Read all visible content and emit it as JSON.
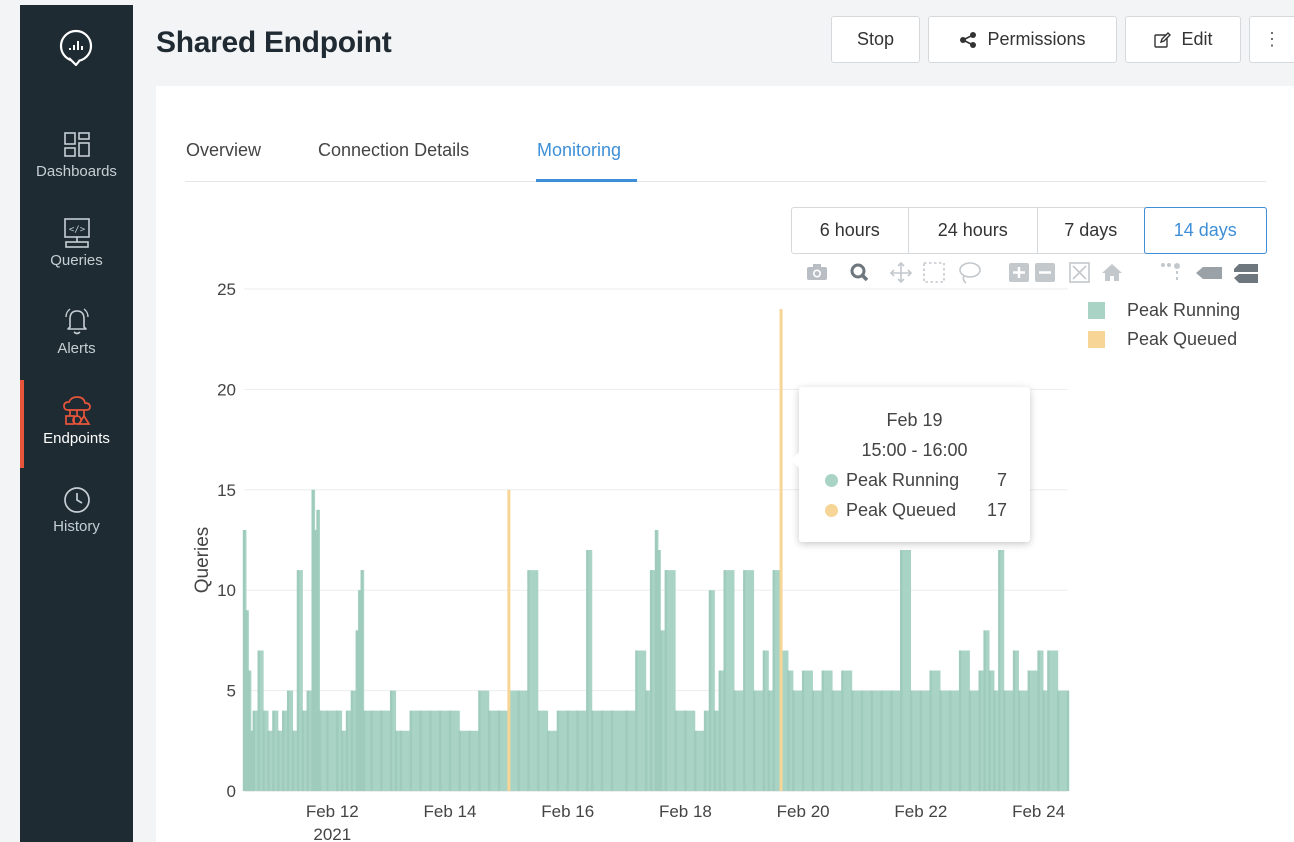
{
  "sidebar": {
    "items": [
      {
        "label": "Dashboards",
        "icon": "dashboards-icon"
      },
      {
        "label": "Queries",
        "icon": "queries-icon"
      },
      {
        "label": "Alerts",
        "icon": "bell-icon"
      },
      {
        "label": "Endpoints",
        "icon": "endpoints-icon",
        "active": true
      },
      {
        "label": "History",
        "icon": "clock-icon"
      }
    ]
  },
  "header": {
    "title": "Shared Endpoint",
    "stop_label": "Stop",
    "permissions_label": "Permissions",
    "edit_label": "Edit",
    "more_label": "⋮"
  },
  "tabs": [
    {
      "label": "Overview"
    },
    {
      "label": "Connection Details"
    },
    {
      "label": "Monitoring",
      "active": true
    }
  ],
  "range": {
    "options": [
      "6 hours",
      "24 hours",
      "7 days",
      "14 days"
    ],
    "selected": "14 days"
  },
  "tooltip": {
    "date": "Feb 19",
    "time": "15:00 - 16:00",
    "rows": [
      {
        "name": "Peak Running",
        "value": "7"
      },
      {
        "name": "Peak Queued",
        "value": "17"
      }
    ]
  },
  "colors": {
    "running": "#a9d4c5",
    "queued": "#f7d597",
    "accent": "#3d8fd8",
    "active_nav": "#e8553b"
  },
  "chart_data": {
    "type": "bar",
    "ylabel": "Queries",
    "ylim": [
      0,
      25
    ],
    "yticks": [
      0,
      5,
      10,
      15,
      20,
      25
    ],
    "xlim": [
      "2021-02-10 12:00",
      "2021-02-24 12:00"
    ],
    "xticks": [
      {
        "date": "2021-02-12",
        "label": "Feb 12",
        "sublabel": "2021"
      },
      {
        "date": "2021-02-14",
        "label": "Feb 14"
      },
      {
        "date": "2021-02-16",
        "label": "Feb 16"
      },
      {
        "date": "2021-02-18",
        "label": "Feb 18"
      },
      {
        "date": "2021-02-20",
        "label": "Feb 20"
      },
      {
        "date": "2021-02-22",
        "label": "Feb 22"
      },
      {
        "date": "2021-02-24",
        "label": "Feb 24"
      }
    ],
    "legend": "top-right",
    "grid": true,
    "series": [
      {
        "name": "Peak Running",
        "color": "#a9d4c5",
        "points": [
          [
            "2021-02-10 12:00",
            13
          ],
          [
            "2021-02-10 13:00",
            9
          ],
          [
            "2021-02-10 14:00",
            6
          ],
          [
            "2021-02-10 15:00",
            3
          ],
          [
            "2021-02-10 16:00",
            4
          ],
          [
            "2021-02-10 18:00",
            7
          ],
          [
            "2021-02-10 20:00",
            4
          ],
          [
            "2021-02-10 22:00",
            3
          ],
          [
            "2021-02-11 00:00",
            4
          ],
          [
            "2021-02-11 02:00",
            3
          ],
          [
            "2021-02-11 04:00",
            4
          ],
          [
            "2021-02-11 06:00",
            5
          ],
          [
            "2021-02-11 08:00",
            3
          ],
          [
            "2021-02-11 10:00",
            11
          ],
          [
            "2021-02-11 12:00",
            4
          ],
          [
            "2021-02-11 14:00",
            5
          ],
          [
            "2021-02-11 16:00",
            15
          ],
          [
            "2021-02-11 17:00",
            13
          ],
          [
            "2021-02-11 18:00",
            14
          ],
          [
            "2021-02-11 19:00",
            4
          ],
          [
            "2021-02-11 22:00",
            4
          ],
          [
            "2021-02-12 02:00",
            4
          ],
          [
            "2021-02-12 04:00",
            3
          ],
          [
            "2021-02-12 06:00",
            4
          ],
          [
            "2021-02-12 08:00",
            5
          ],
          [
            "2021-02-12 10:00",
            8
          ],
          [
            "2021-02-12 11:00",
            10
          ],
          [
            "2021-02-12 12:00",
            11
          ],
          [
            "2021-02-12 13:00",
            4
          ],
          [
            "2021-02-12 16:00",
            4
          ],
          [
            "2021-02-12 20:00",
            4
          ],
          [
            "2021-02-13 00:00",
            5
          ],
          [
            "2021-02-13 02:00",
            3
          ],
          [
            "2021-02-13 04:00",
            3
          ],
          [
            "2021-02-13 08:00",
            4
          ],
          [
            "2021-02-13 12:00",
            4
          ],
          [
            "2021-02-13 16:00",
            4
          ],
          [
            "2021-02-13 20:00",
            4
          ],
          [
            "2021-02-14 00:00",
            4
          ],
          [
            "2021-02-14 04:00",
            3
          ],
          [
            "2021-02-14 08:00",
            3
          ],
          [
            "2021-02-14 12:00",
            5
          ],
          [
            "2021-02-14 16:00",
            4
          ],
          [
            "2021-02-14 20:00",
            4
          ],
          [
            "2021-02-15 00:00",
            5
          ],
          [
            "2021-02-15 04:00",
            5
          ],
          [
            "2021-02-15 08:00",
            11
          ],
          [
            "2021-02-15 12:00",
            4
          ],
          [
            "2021-02-15 16:00",
            3
          ],
          [
            "2021-02-15 20:00",
            4
          ],
          [
            "2021-02-16 00:00",
            4
          ],
          [
            "2021-02-16 04:00",
            4
          ],
          [
            "2021-02-16 08:00",
            12
          ],
          [
            "2021-02-16 10:00",
            4
          ],
          [
            "2021-02-16 14:00",
            4
          ],
          [
            "2021-02-16 18:00",
            4
          ],
          [
            "2021-02-17 00:00",
            4
          ],
          [
            "2021-02-17 04:00",
            7
          ],
          [
            "2021-02-17 08:00",
            5
          ],
          [
            "2021-02-17 10:00",
            11
          ],
          [
            "2021-02-17 12:00",
            13
          ],
          [
            "2021-02-17 13:00",
            12
          ],
          [
            "2021-02-17 14:00",
            8
          ],
          [
            "2021-02-17 16:00",
            11
          ],
          [
            "2021-02-17 20:00",
            4
          ],
          [
            "2021-02-18 00:00",
            4
          ],
          [
            "2021-02-18 04:00",
            3
          ],
          [
            "2021-02-18 08:00",
            4
          ],
          [
            "2021-02-18 10:00",
            10
          ],
          [
            "2021-02-18 12:00",
            4
          ],
          [
            "2021-02-18 14:00",
            6
          ],
          [
            "2021-02-18 16:00",
            11
          ],
          [
            "2021-02-18 20:00",
            5
          ],
          [
            "2021-02-19 00:00",
            11
          ],
          [
            "2021-02-19 04:00",
            5
          ],
          [
            "2021-02-19 08:00",
            7
          ],
          [
            "2021-02-19 10:00",
            5
          ],
          [
            "2021-02-19 12:00",
            11
          ],
          [
            "2021-02-19 15:00",
            7
          ],
          [
            "2021-02-19 18:00",
            6
          ],
          [
            "2021-02-19 20:00",
            5
          ],
          [
            "2021-02-20 00:00",
            6
          ],
          [
            "2021-02-20 04:00",
            5
          ],
          [
            "2021-02-20 08:00",
            6
          ],
          [
            "2021-02-20 12:00",
            5
          ],
          [
            "2021-02-20 16:00",
            6
          ],
          [
            "2021-02-20 20:00",
            5
          ],
          [
            "2021-02-21 00:00",
            5
          ],
          [
            "2021-02-21 04:00",
            5
          ],
          [
            "2021-02-21 08:00",
            5
          ],
          [
            "2021-02-21 12:00",
            5
          ],
          [
            "2021-02-21 16:00",
            12
          ],
          [
            "2021-02-21 20:00",
            5
          ],
          [
            "2021-02-22 00:00",
            5
          ],
          [
            "2021-02-22 04:00",
            6
          ],
          [
            "2021-02-22 08:00",
            5
          ],
          [
            "2021-02-22 12:00",
            5
          ],
          [
            "2021-02-22 16:00",
            7
          ],
          [
            "2021-02-22 20:00",
            5
          ],
          [
            "2021-02-23 00:00",
            6
          ],
          [
            "2021-02-23 02:00",
            8
          ],
          [
            "2021-02-23 04:00",
            6
          ],
          [
            "2021-02-23 06:00",
            5
          ],
          [
            "2021-02-23 08:00",
            12
          ],
          [
            "2021-02-23 10:00",
            5
          ],
          [
            "2021-02-23 14:00",
            7
          ],
          [
            "2021-02-23 16:00",
            5
          ],
          [
            "2021-02-23 20:00",
            6
          ],
          [
            "2021-02-24 00:00",
            7
          ],
          [
            "2021-02-24 02:00",
            5
          ],
          [
            "2021-02-24 04:00",
            7
          ],
          [
            "2021-02-24 08:00",
            5
          ],
          [
            "2021-02-24 12:00",
            5
          ]
        ]
      },
      {
        "name": "Peak Queued",
        "color": "#f7d597",
        "points": [
          [
            "2021-02-15 00:00",
            15
          ],
          [
            "2021-02-19 15:00",
            24
          ]
        ]
      }
    ]
  }
}
